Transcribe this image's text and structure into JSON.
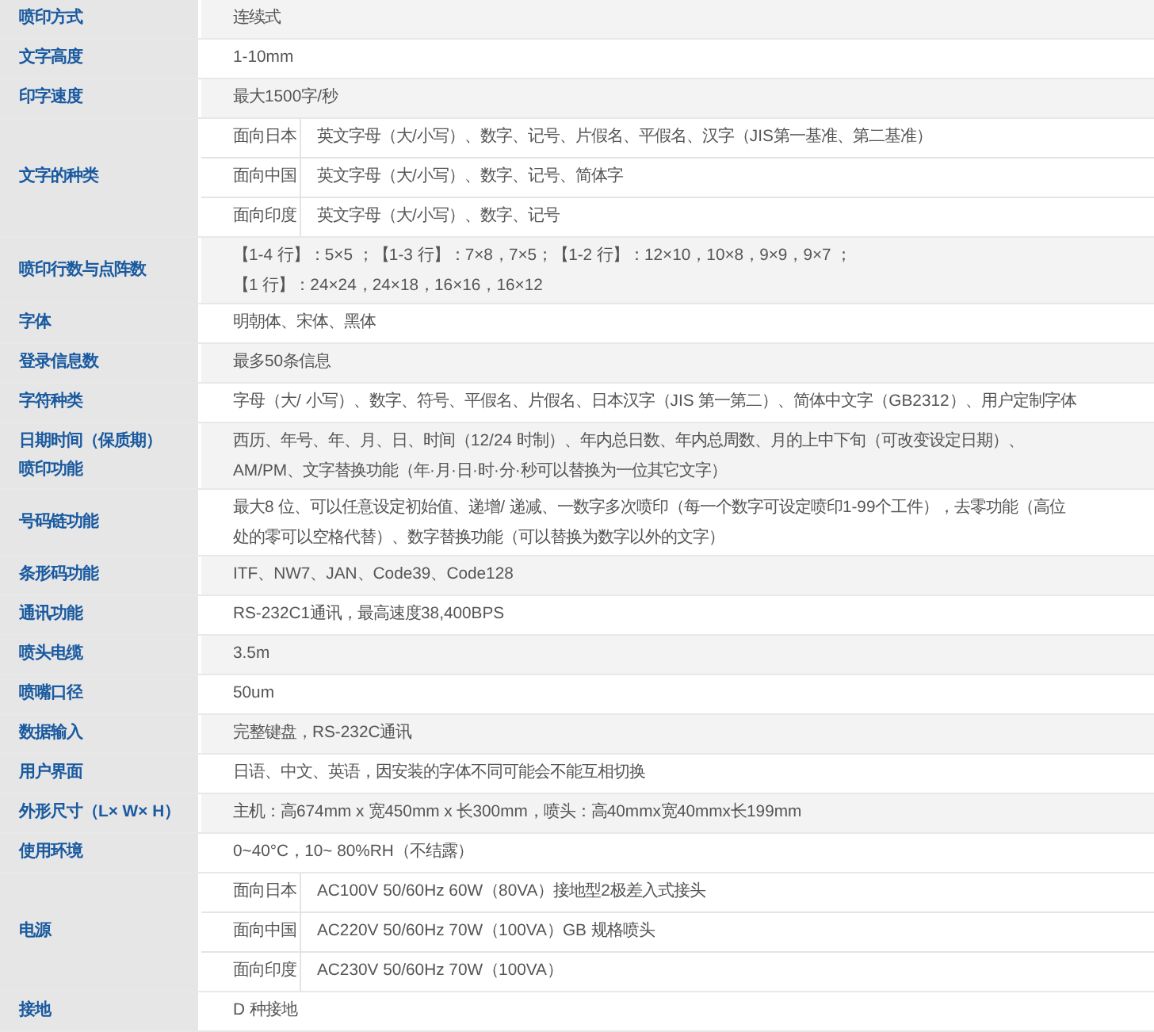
{
  "rows": [
    {
      "kind": "text",
      "label": "喷印方式",
      "value": "连续式"
    },
    {
      "kind": "text",
      "label": "文字高度",
      "value": "1-10mm"
    },
    {
      "kind": "text",
      "label": "印字速度",
      "value": "最大1500字/秒"
    },
    {
      "kind": "sub",
      "label": "文字的种类",
      "items": [
        {
          "region": "面向日本",
          "value": "英文字母（大/小写）、数字、记号、片假名、平假名、汉字（JIS第一基准、第二基准）"
        },
        {
          "region": "面向中国",
          "value": "英文字母（大/小写）、数字、记号、简体字"
        },
        {
          "region": "面向印度",
          "value": "英文字母（大/小写）、数字、记号"
        }
      ]
    },
    {
      "kind": "lines",
      "label": "喷印行数与点阵数",
      "lines": [
        "【1-4 行】：5×5 ；【1-3 行】：7×8，7×5；【1-2 行】：12×10，10×8，9×9，9×7 ；",
        "【1 行】：24×24，24×18，16×16，16×12"
      ]
    },
    {
      "kind": "text",
      "label": "字体",
      "value": "明朝体、宋体、黑体"
    },
    {
      "kind": "text",
      "label": "登录信息数",
      "value": "最多50条信息"
    },
    {
      "kind": "text",
      "label": "字符种类",
      "value": "字母（大/ 小写）、数字、符号、平假名、片假名、日本汉字（JIS 第一第二）、简体中文字（GB2312）、用户定制字体"
    },
    {
      "kind": "lines",
      "label_lines": [
        "日期时间（保质期）",
        "喷印功能"
      ],
      "lines": [
        "西历、年号、年、月、日、时间（12/24 时制）、年内总日数、年内总周数、月的上中下旬（可改变设定日期）、",
        "AM/PM、文字替换功能（年·月·日·时·分·秒可以替换为一位其它文字）"
      ]
    },
    {
      "kind": "lines",
      "label": "号码链功能",
      "lines": [
        "最大8 位、可以任意设定初始值、递增/ 递减、一数字多次喷印（每一个数字可设定喷印1-99个工件），去零功能（高位",
        "处的零可以空格代替）、数字替换功能（可以替换为数字以外的文字）"
      ]
    },
    {
      "kind": "text",
      "label": "条形码功能",
      "value": "ITF、NW7、JAN、Code39、Code128"
    },
    {
      "kind": "text",
      "label": "通讯功能",
      "value": "RS-232C1通讯，最高速度38,400BPS"
    },
    {
      "kind": "text",
      "label": "喷头电缆",
      "value": "3.5m"
    },
    {
      "kind": "text",
      "label": "喷嘴口径",
      "value": "50um"
    },
    {
      "kind": "text",
      "label": "数据输入",
      "value": "完整键盘，RS-232C通讯"
    },
    {
      "kind": "text",
      "label": "用户界面",
      "value": "日语、中文、英语，因安装的字体不同可能会不能互相切换"
    },
    {
      "kind": "text",
      "label": "外形尺寸（L× W× H）",
      "value": "主机：高674mm x 宽450mm x 长300mm，喷头：高40mmx宽40mmx长199mm"
    },
    {
      "kind": "text",
      "label": "使用环境",
      "value": "0~40°C，10~ 80%RH（不结露）"
    },
    {
      "kind": "sub",
      "label": "电源",
      "items": [
        {
          "region": "面向日本",
          "value": "AC100V 50/60Hz 60W（80VA）接地型2极差入式接头"
        },
        {
          "region": "面向中国",
          "value": "AC220V 50/60Hz 70W（100VA）GB 规格喷头"
        },
        {
          "region": "面向印度",
          "value": "AC230V 50/60Hz 70W（100VA）"
        }
      ]
    },
    {
      "kind": "text",
      "label": "接地",
      "value": "D 种接地"
    }
  ]
}
